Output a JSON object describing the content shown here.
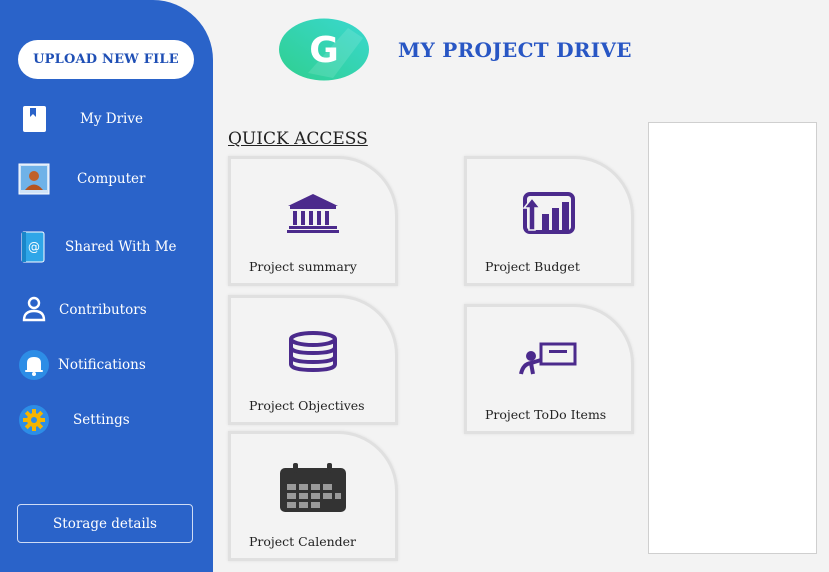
{
  "app": {
    "title": "MY PROJECT DRIVE",
    "logo_letter": "G"
  },
  "sidebar": {
    "upload_label": "UPLOAD NEW FILE",
    "items": [
      {
        "label": "My Drive",
        "icon": "book-icon"
      },
      {
        "label": "Computer",
        "icon": "computer-icon"
      },
      {
        "label": "Shared With Me",
        "icon": "contact-book-icon"
      },
      {
        "label": "Contributors",
        "icon": "person-icon"
      },
      {
        "label": "Notifications",
        "icon": "bell-icon"
      },
      {
        "label": "Settings",
        "icon": "gear-icon"
      }
    ],
    "storage_label": "Storage details"
  },
  "quick_access": {
    "title": "QUICK ACCESS",
    "cards": [
      {
        "label": "Project summary",
        "icon": "bank-icon"
      },
      {
        "label": "Project Budget",
        "icon": "bar-chart-icon"
      },
      {
        "label": "Project Objectives",
        "icon": "database-icon"
      },
      {
        "label": "Project ToDo Items",
        "icon": "presentation-icon"
      },
      {
        "label": "Project Calender",
        "icon": "calendar-icon"
      }
    ]
  },
  "colors": {
    "sidebar": "#2a63c9",
    "title": "#2856c4",
    "icon_purple": "#4b2a8c"
  }
}
